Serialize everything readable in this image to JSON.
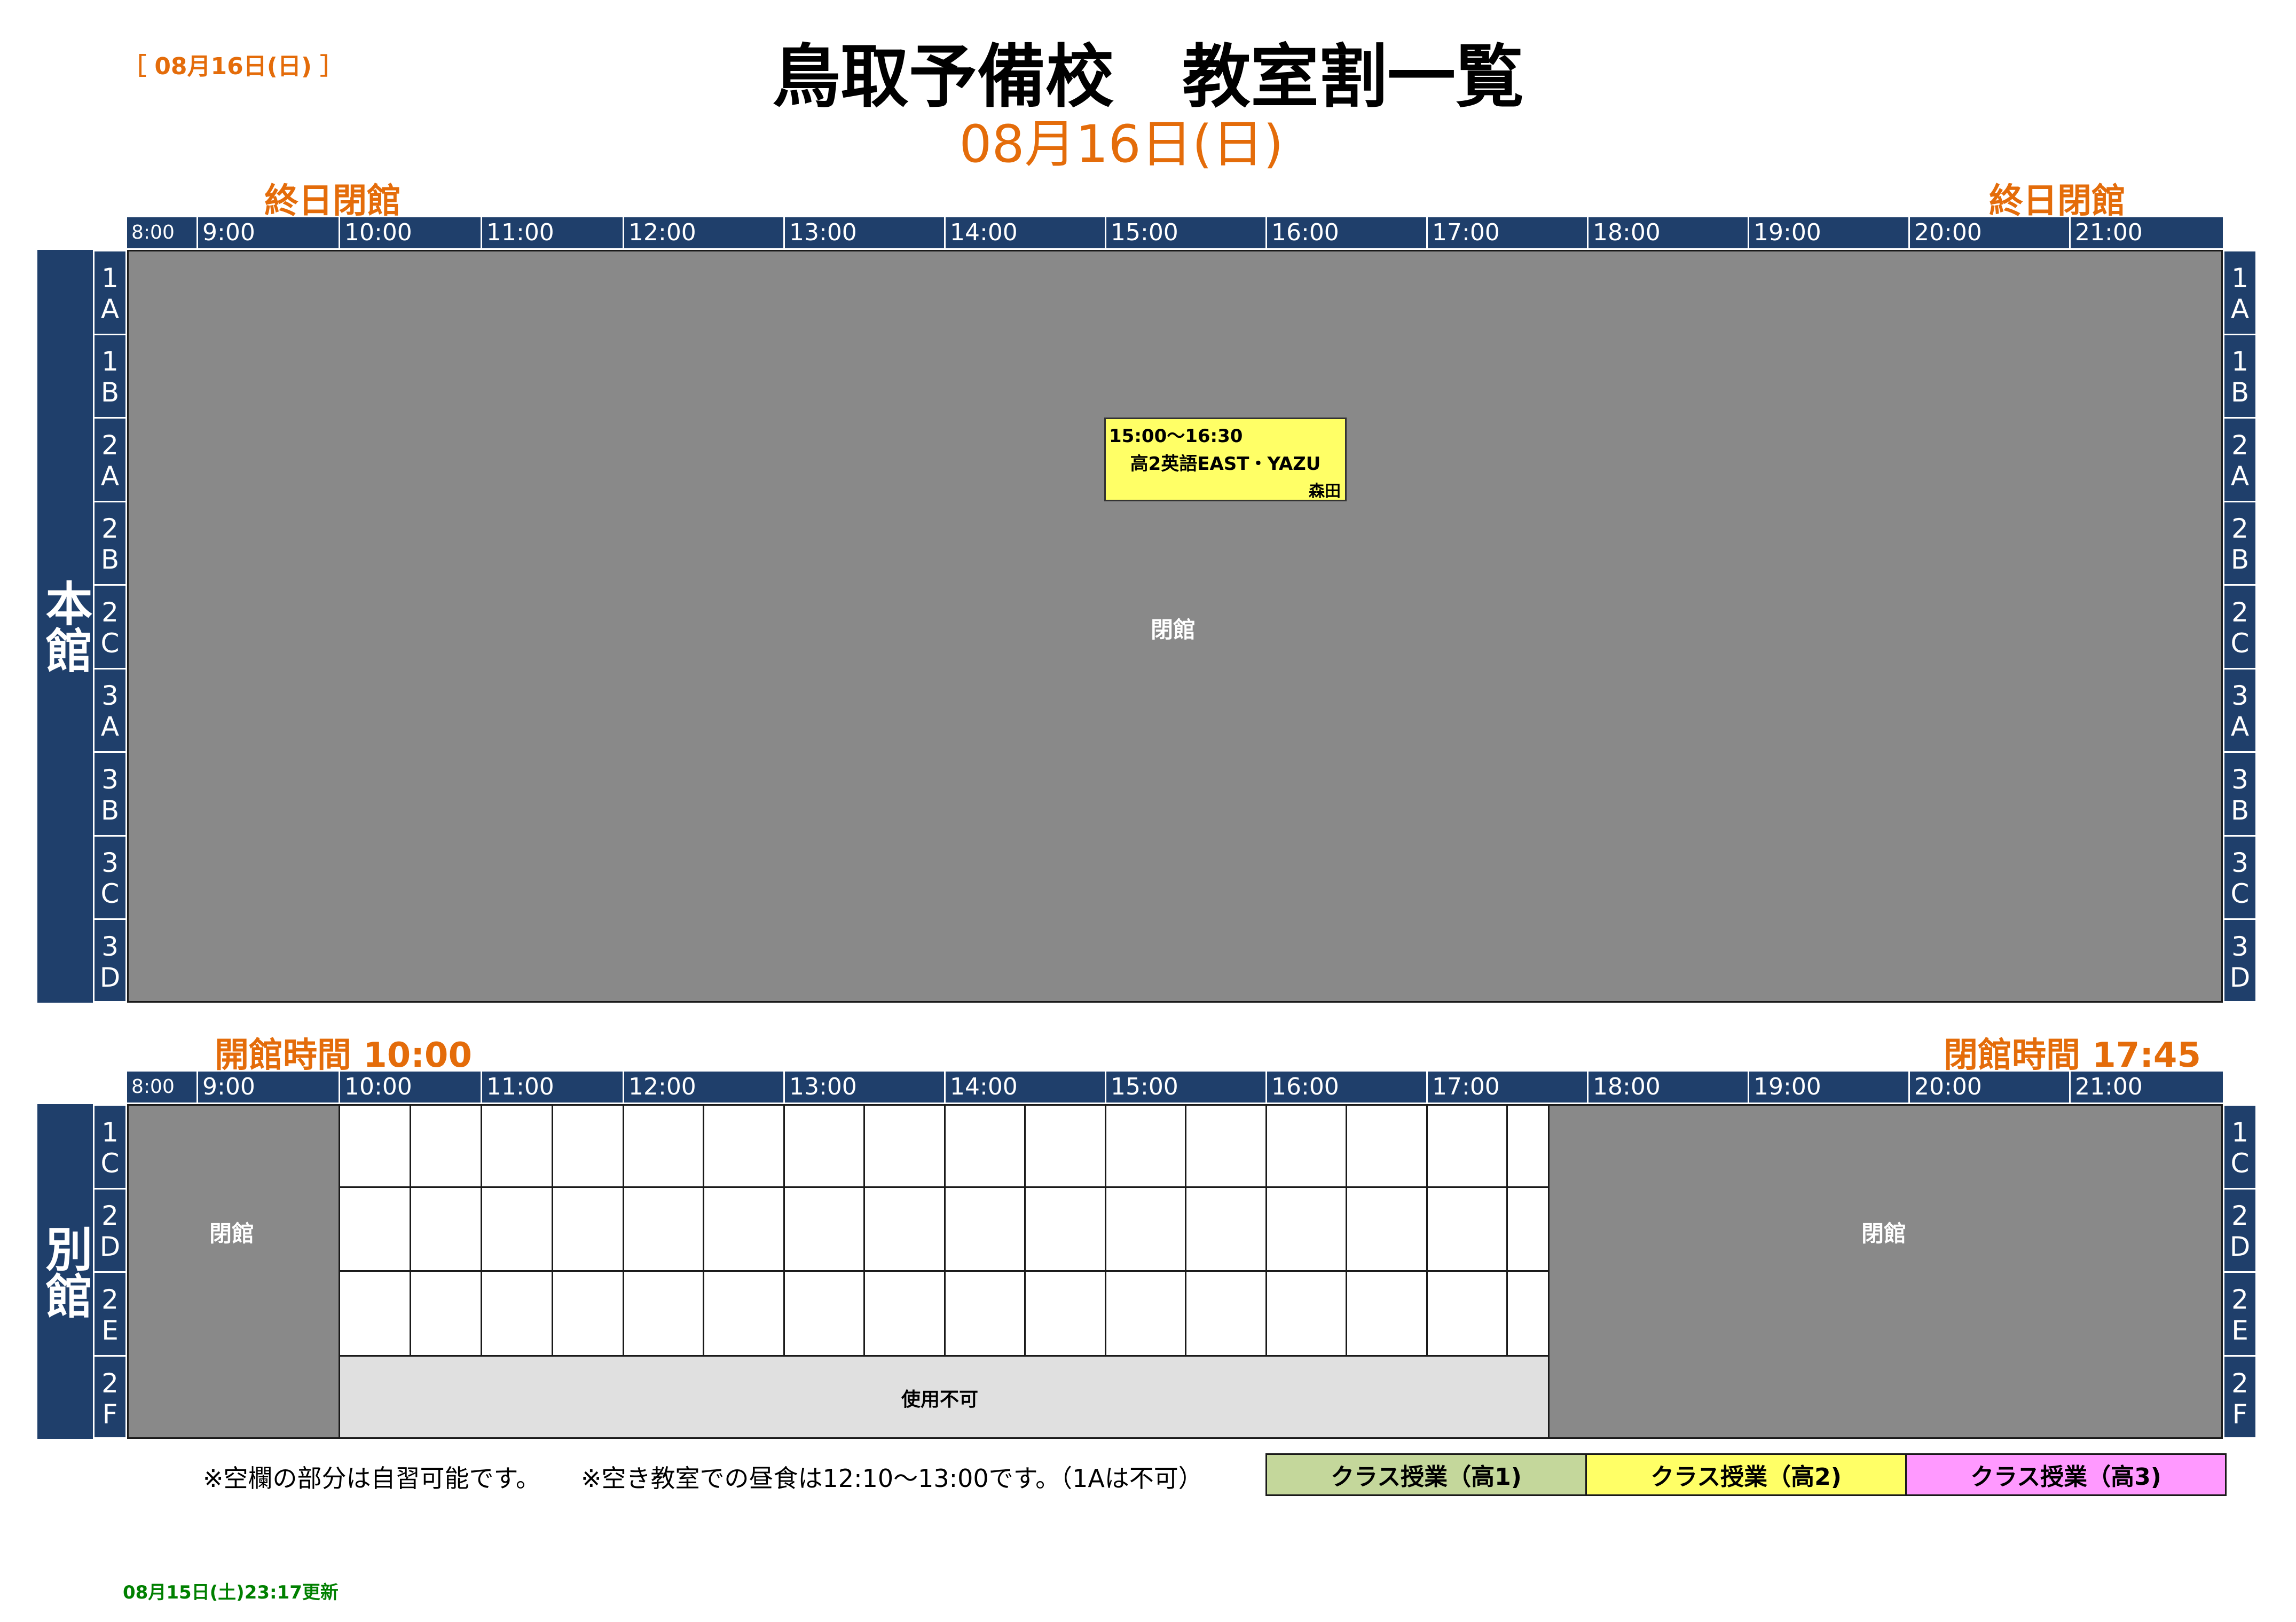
{
  "date_tag": "［ 08月16日(日) ］",
  "title": "鳥取予備校　教室割一覧",
  "subtitle_date": "08月16日(日)",
  "hours": [
    "8:00",
    "9:00",
    "10:00",
    "11:00",
    "12:00",
    "13:00",
    "14:00",
    "15:00",
    "16:00",
    "17:00",
    "18:00",
    "19:00",
    "20:00",
    "21:00"
  ],
  "main_building": {
    "label_left": "終日閉館",
    "label_right": "終日閉館",
    "name": "本館",
    "rooms": [
      [
        "1",
        "A"
      ],
      [
        "1",
        "B"
      ],
      [
        "2",
        "A"
      ],
      [
        "2",
        "B"
      ],
      [
        "2",
        "C"
      ],
      [
        "3",
        "A"
      ],
      [
        "3",
        "B"
      ],
      [
        "3",
        "C"
      ],
      [
        "3",
        "D"
      ]
    ],
    "closed_text": "閉館",
    "class_block": {
      "time": "15:00～16:30",
      "name": "高2英語EAST・YAZU",
      "teacher": "森田"
    }
  },
  "annex_building": {
    "label_left": "開館時間 10:00",
    "label_right": "閉館時間 17:45",
    "name": "別館",
    "rooms": [
      [
        "1",
        "C"
      ],
      [
        "2",
        "D"
      ],
      [
        "2",
        "E"
      ],
      [
        "2",
        "F"
      ]
    ],
    "closed_left": "閉館",
    "closed_right": "閉館",
    "unavailable": "使用不可"
  },
  "notes": {
    "note1": "※空欄の部分は自習可能です。",
    "note2": "※空き教室での昼食は12:10～13:00です。（1Aは不可）"
  },
  "legend": [
    {
      "label": "クラス授業（高1)",
      "color": "#c4d79b"
    },
    {
      "label": "クラス授業（高2)",
      "color": "#ffff66"
    },
    {
      "label": "クラス授業（高3)",
      "color": "#ff99ff"
    }
  ],
  "updated": "08月15日(土)23:17更新",
  "colors": {
    "navy": "#1f3f6b",
    "orange": "#e46c0a",
    "closed_gray": "#898989",
    "unavailable_gray": "#e0e0e0",
    "update_green": "#008000"
  }
}
